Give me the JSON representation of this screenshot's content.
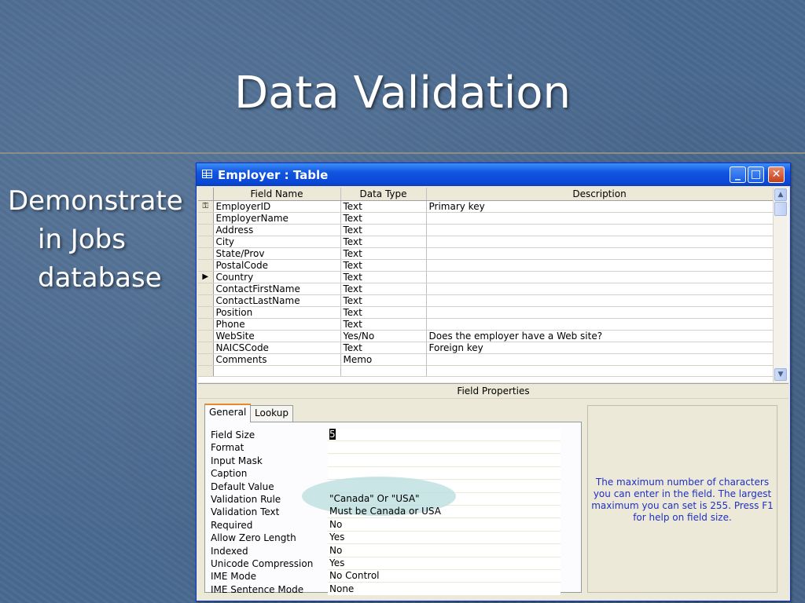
{
  "slide": {
    "title": "Data Validation",
    "bullet_line1": "Demonstrate",
    "bullet_line2": "in Jobs",
    "bullet_line3": "database"
  },
  "window": {
    "title": "Employer : Table",
    "icon": "table-icon",
    "minimize": "_",
    "maximize": "□",
    "close": "✕"
  },
  "grid": {
    "columns": [
      "Field Name",
      "Data Type",
      "Description"
    ],
    "rows": [
      {
        "marker": "key",
        "name": "EmployerID",
        "type": "Text",
        "desc": "Primary key"
      },
      {
        "marker": "",
        "name": "EmployerName",
        "type": "Text",
        "desc": ""
      },
      {
        "marker": "",
        "name": "Address",
        "type": "Text",
        "desc": ""
      },
      {
        "marker": "",
        "name": "City",
        "type": "Text",
        "desc": ""
      },
      {
        "marker": "",
        "name": "State/Prov",
        "type": "Text",
        "desc": ""
      },
      {
        "marker": "",
        "name": "PostalCode",
        "type": "Text",
        "desc": ""
      },
      {
        "marker": "current",
        "name": "Country",
        "type": "Text",
        "desc": ""
      },
      {
        "marker": "",
        "name": "ContactFirstName",
        "type": "Text",
        "desc": ""
      },
      {
        "marker": "",
        "name": "ContactLastName",
        "type": "Text",
        "desc": ""
      },
      {
        "marker": "",
        "name": "Position",
        "type": "Text",
        "desc": ""
      },
      {
        "marker": "",
        "name": "Phone",
        "type": "Text",
        "desc": ""
      },
      {
        "marker": "",
        "name": "WebSite",
        "type": "Yes/No",
        "desc": "Does the employer have a Web site?"
      },
      {
        "marker": "",
        "name": "NAICSCode",
        "type": "Text",
        "desc": "Foreign key"
      },
      {
        "marker": "",
        "name": "Comments",
        "type": "Memo",
        "desc": ""
      },
      {
        "marker": "",
        "name": "",
        "type": "",
        "desc": ""
      }
    ]
  },
  "field_properties": {
    "header": "Field Properties",
    "tabs": [
      "General",
      "Lookup"
    ],
    "active_tab": "General",
    "rows": [
      {
        "label": "Field Size",
        "value": "5"
      },
      {
        "label": "Format",
        "value": ""
      },
      {
        "label": "Input Mask",
        "value": ""
      },
      {
        "label": "Caption",
        "value": ""
      },
      {
        "label": "Default Value",
        "value": ""
      },
      {
        "label": "Validation Rule",
        "value": "\"Canada\" Or \"USA\""
      },
      {
        "label": "Validation Text",
        "value": "Must be Canada or USA"
      },
      {
        "label": "Required",
        "value": "No"
      },
      {
        "label": "Allow Zero Length",
        "value": "Yes"
      },
      {
        "label": "Indexed",
        "value": "No"
      },
      {
        "label": "Unicode Compression",
        "value": "Yes"
      },
      {
        "label": "IME Mode",
        "value": "No Control"
      },
      {
        "label": "IME Sentence Mode",
        "value": "None"
      }
    ],
    "help_text": "The maximum number of characters you can enter in the field.  The largest maximum you can set is 255.  Press F1 for help on field size."
  },
  "colors": {
    "background": "#4a6a90",
    "titlebar": "#0a48d6",
    "help_text": "#2030c0",
    "highlight": "#badede"
  }
}
